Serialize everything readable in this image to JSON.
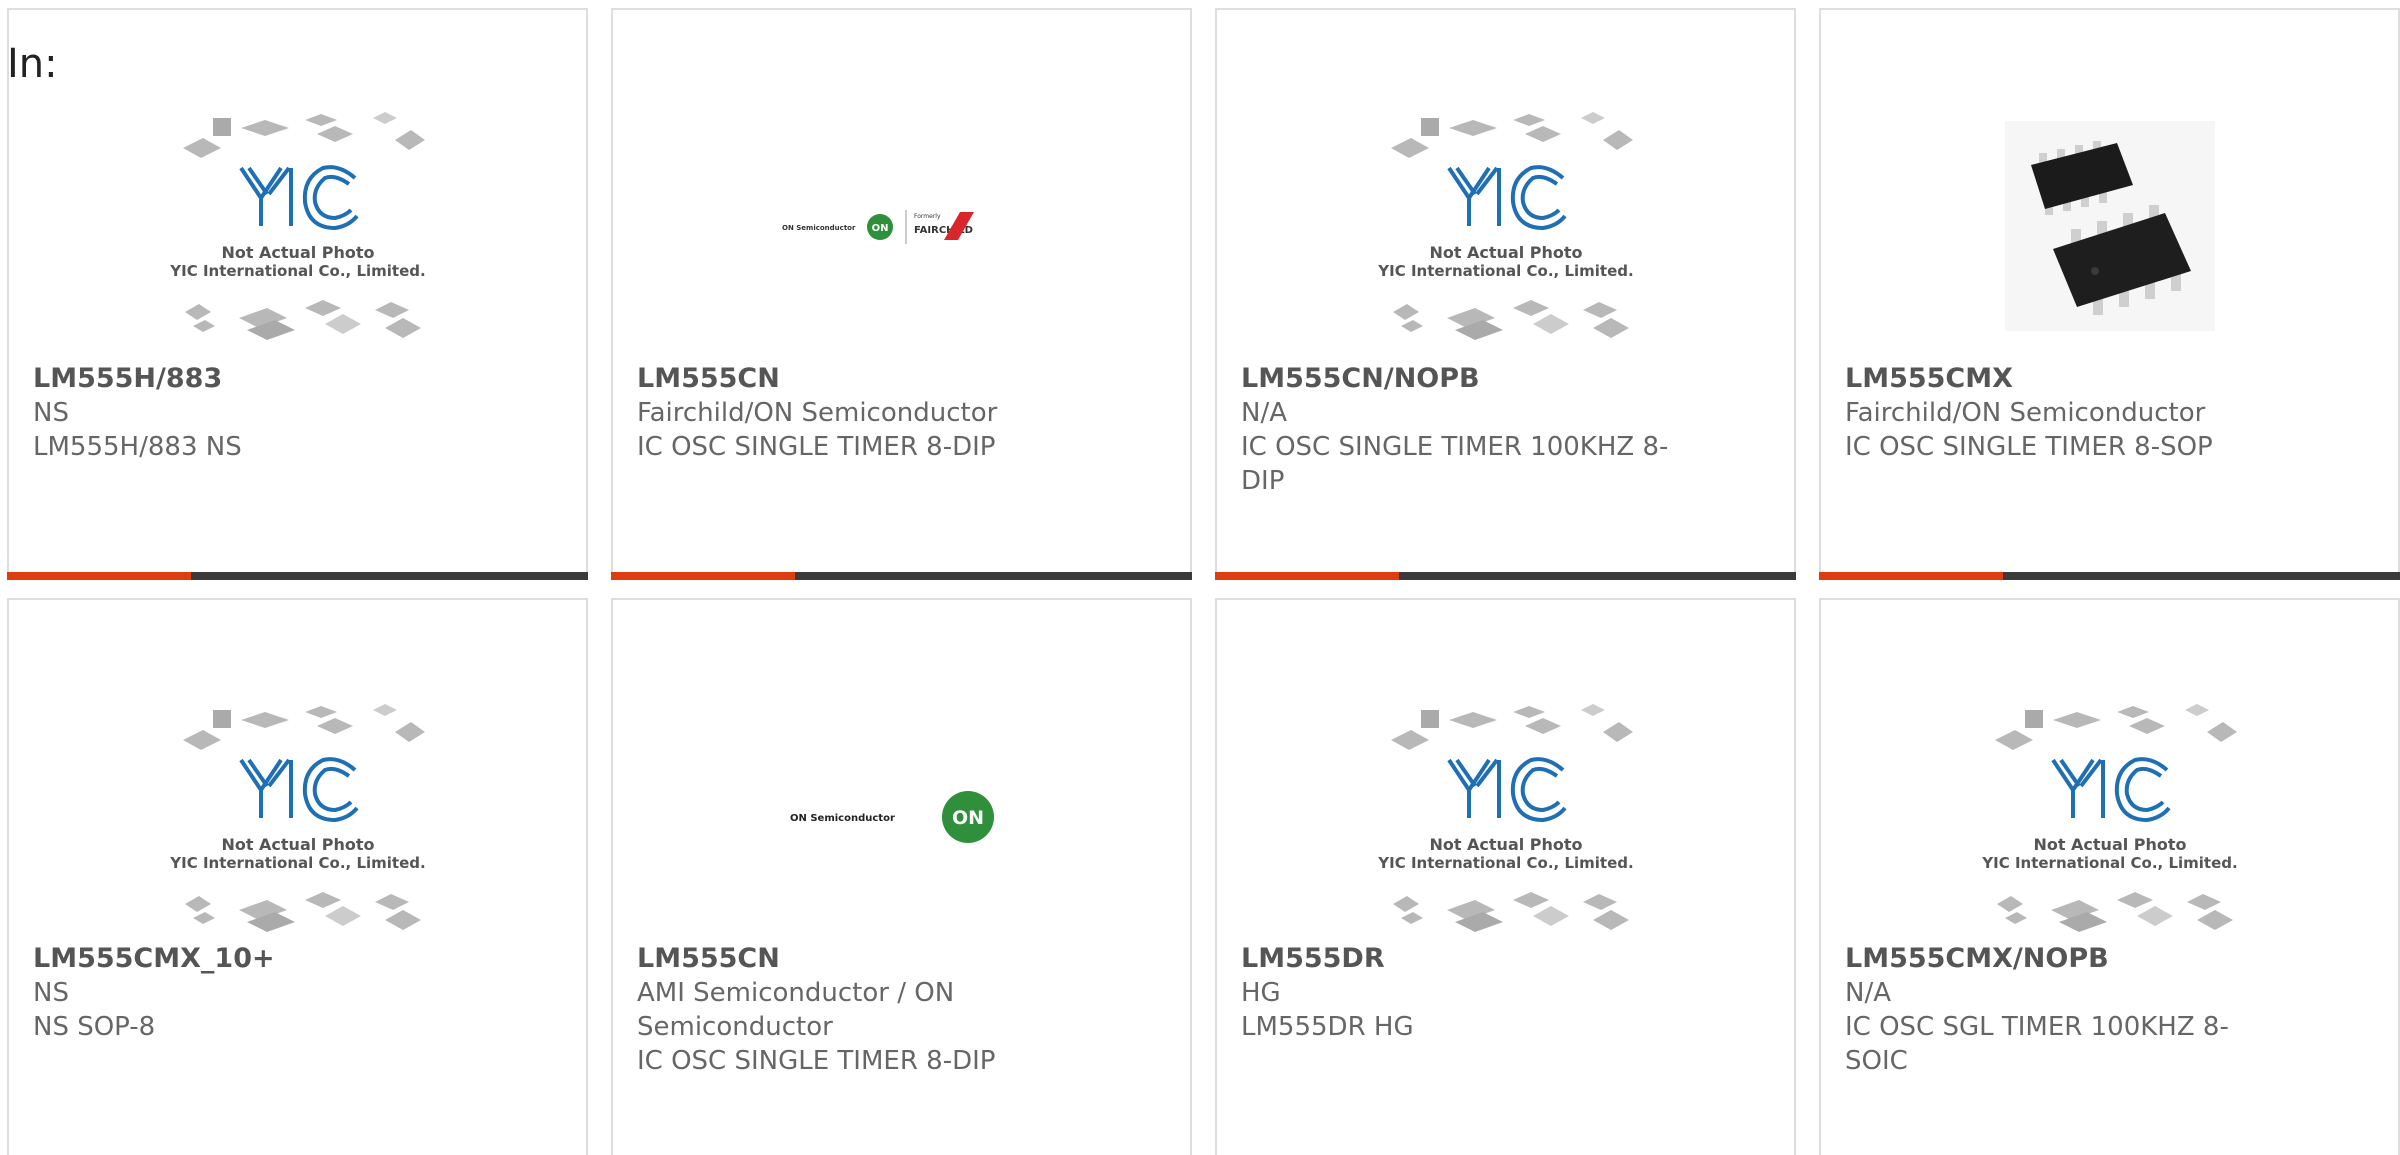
{
  "heading": "In:",
  "colors": {
    "accent": "#e03c12",
    "bar": "#3a3a3a",
    "border": "#dddddd",
    "yic_blue": "#1f6fb5",
    "on_green": "#2f8f3a",
    "fairchild_red": "#d9262b"
  },
  "placeholder": {
    "line1": "Not Actual Photo",
    "line2": "YIC International Co., Limited.",
    "logo": "YIC"
  },
  "logos": {
    "on_semi": "ON Semiconductor",
    "on_badge": "ON",
    "formerly": "Formerly",
    "fairchild": "FAIRCHILD"
  },
  "products": [
    {
      "part": "LM555H/883",
      "maker": "NS",
      "desc": "LM555H/883 NS",
      "image": "yic-placeholder"
    },
    {
      "part": "LM555CN",
      "maker": "Fairchild/ON Semiconductor",
      "desc": "IC OSC SINGLE TIMER 8-DIP",
      "image": "on-fairchild-logo"
    },
    {
      "part": "LM555CN/NOPB",
      "maker": "N/A",
      "desc": "IC OSC SINGLE TIMER 100KHZ 8-DIP",
      "image": "yic-placeholder"
    },
    {
      "part": "LM555CMX",
      "maker": "Fairchild/ON Semiconductor",
      "desc": "IC OSC SINGLE TIMER 8-SOP",
      "image": "soic-chip-photo"
    },
    {
      "part": "LM555CMX_10+",
      "maker": "NS",
      "desc": "NS SOP-8",
      "image": "yic-placeholder"
    },
    {
      "part": "LM555CN",
      "maker": "AMI Semiconductor / ON Semiconductor",
      "desc": "IC OSC SINGLE TIMER 8-DIP",
      "image": "on-semi-logo"
    },
    {
      "part": "LM555DR",
      "maker": "HG",
      "desc": "LM555DR HG",
      "image": "yic-placeholder"
    },
    {
      "part": "LM555CMX/NOPB",
      "maker": "N/A",
      "desc": "IC OSC SGL TIMER 100KHZ 8-SOIC",
      "image": "yic-placeholder"
    }
  ]
}
